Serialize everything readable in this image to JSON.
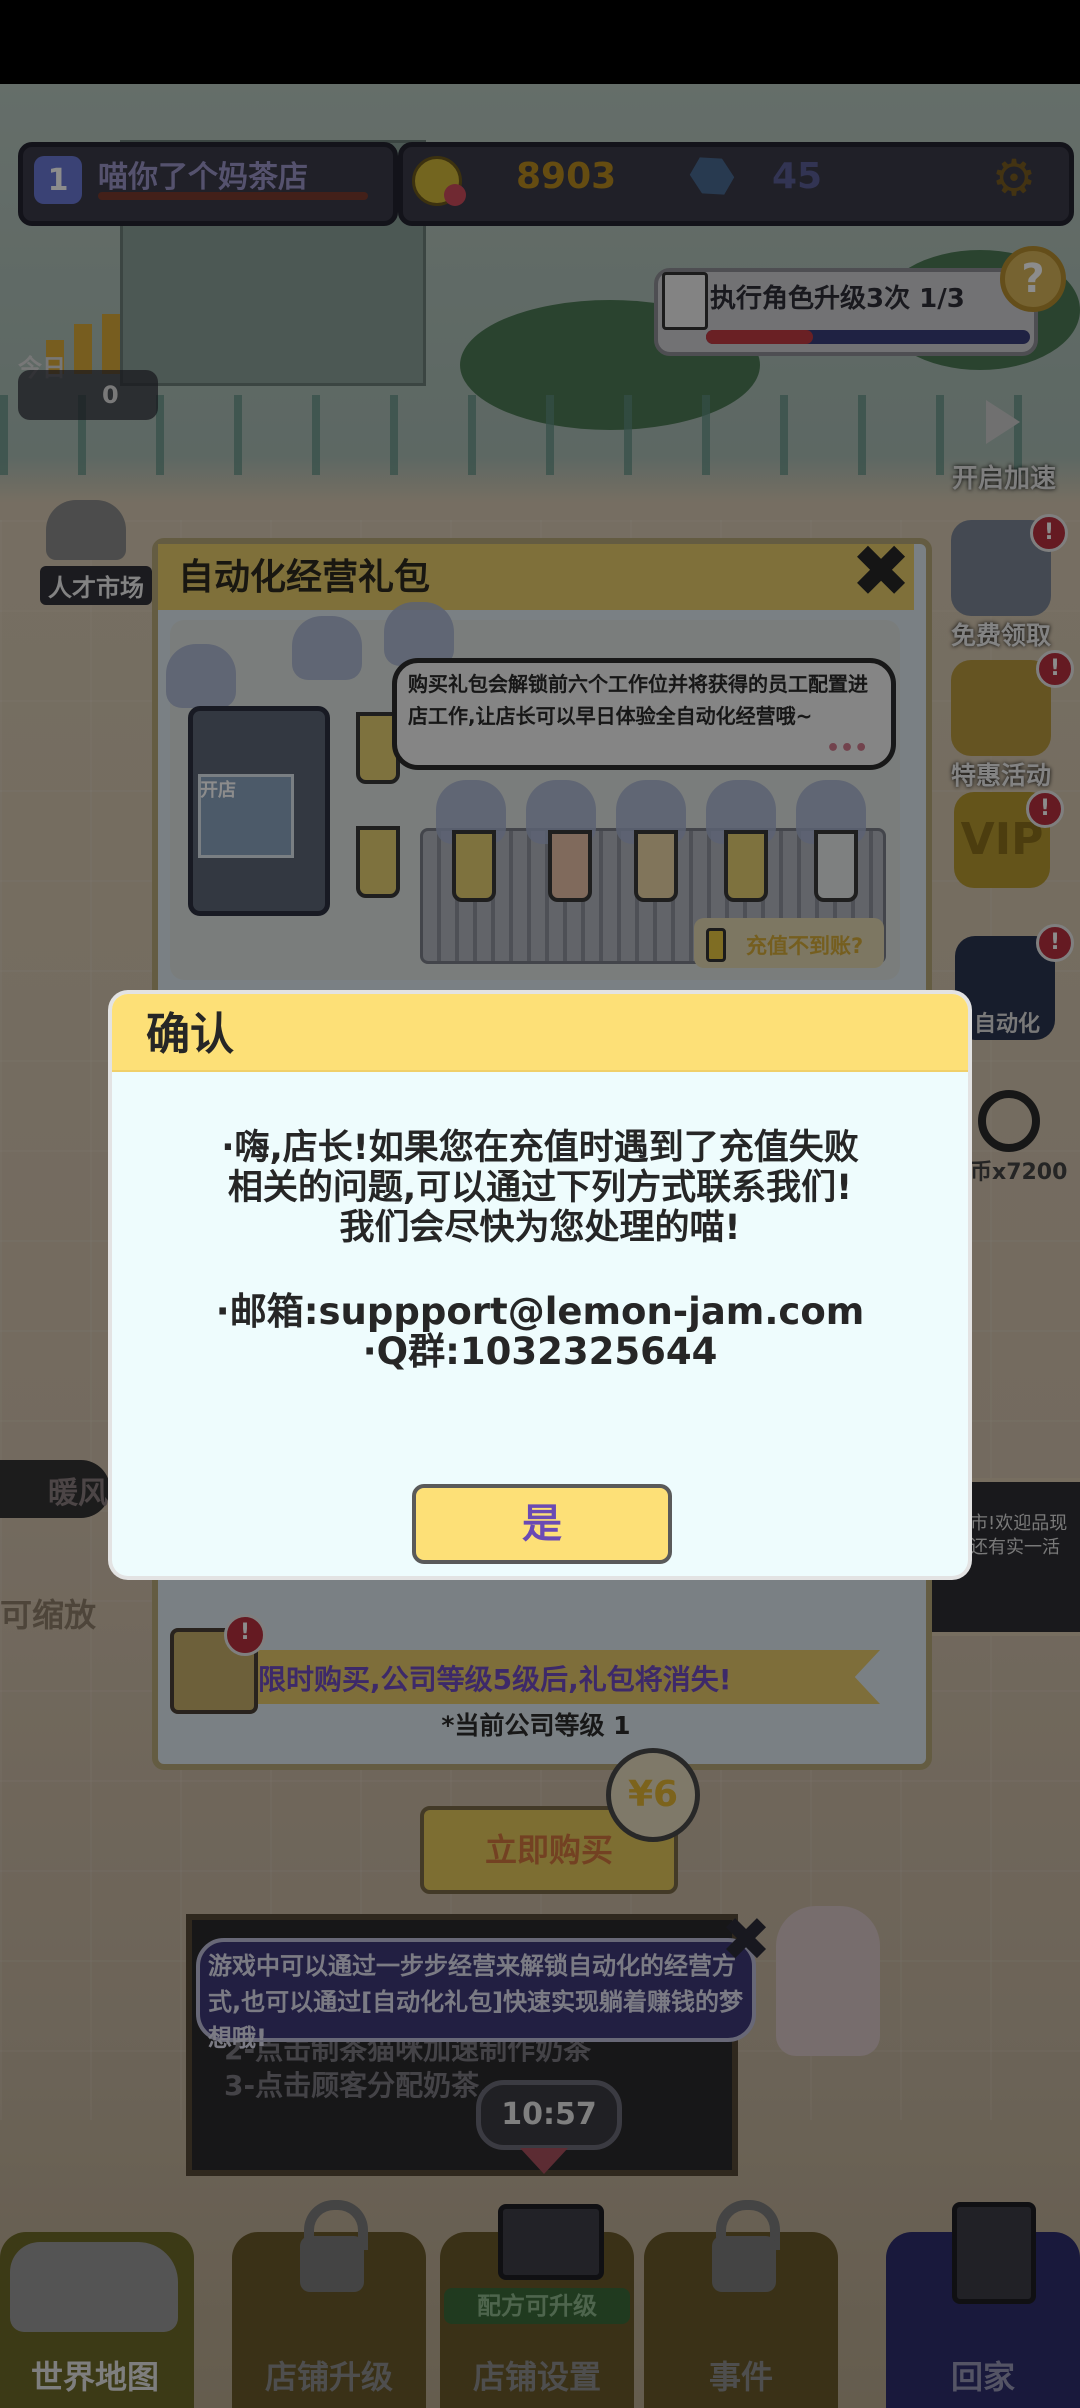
{
  "hud": {
    "level": "1",
    "shop_name": "喵你了个妈茶店",
    "gold": "8903",
    "gems": "45"
  },
  "quest": {
    "text": "执行角色升级3次 1/3",
    "progress": 0.33
  },
  "today": {
    "label": "今日",
    "value": "0"
  },
  "speed_label": "开启加速",
  "talent_label": "人才市场",
  "side": {
    "free": "免费领取",
    "special": "特惠活动",
    "vip": "VIP",
    "auto": "自动化",
    "coins": "币x7200",
    "badge": "!"
  },
  "warm_label": "暖风",
  "zoom_label": "可缩放",
  "notice_text": "款上市!欢迎品现店内还有实一活动!",
  "package": {
    "title": "自动化经营礼包",
    "bubble_text": "购买礼包会解锁前六个工作位并将获得的员工配置进店工作,让店长可以早日体验全自动化经营哦~",
    "dots": "•••",
    "machine_label": "开店",
    "recharge": "充值不到账?",
    "limit_text": "限时购买,公司等级5级后,礼包将消失!",
    "level_text": "*当前公司等级  1",
    "price": "¥6",
    "buy": "立即购买"
  },
  "guide": {
    "bubble_text": "游戏中可以通过一步步经营来解锁自动化的经营方式,也可以通过[自动化礼包]快速实现躺着赚钱的梦想哦!",
    "lines": [
      "2-点击制茶猫咪加速制作奶茶",
      "3-点击顾客分配奶茶,"
    ],
    "timer": "10:57"
  },
  "nav": {
    "world_map": "世界地图",
    "upgrade": "店铺升级",
    "settings": "店铺设置",
    "settings_tag": "配方可升级",
    "events": "事件",
    "recycle": "回家"
  },
  "dialog": {
    "title": "确认",
    "line1": "·嗨,店长!如果您在充值时遇到了充值失败",
    "line2": "相关的问题,可以通过下列方式联系我们!",
    "line3": "我们会尽快为您处理的喵!",
    "email": "·邮箱:suppport@lemon-jam.com",
    "qq": "·Q群:1032325644",
    "yes": "是"
  }
}
